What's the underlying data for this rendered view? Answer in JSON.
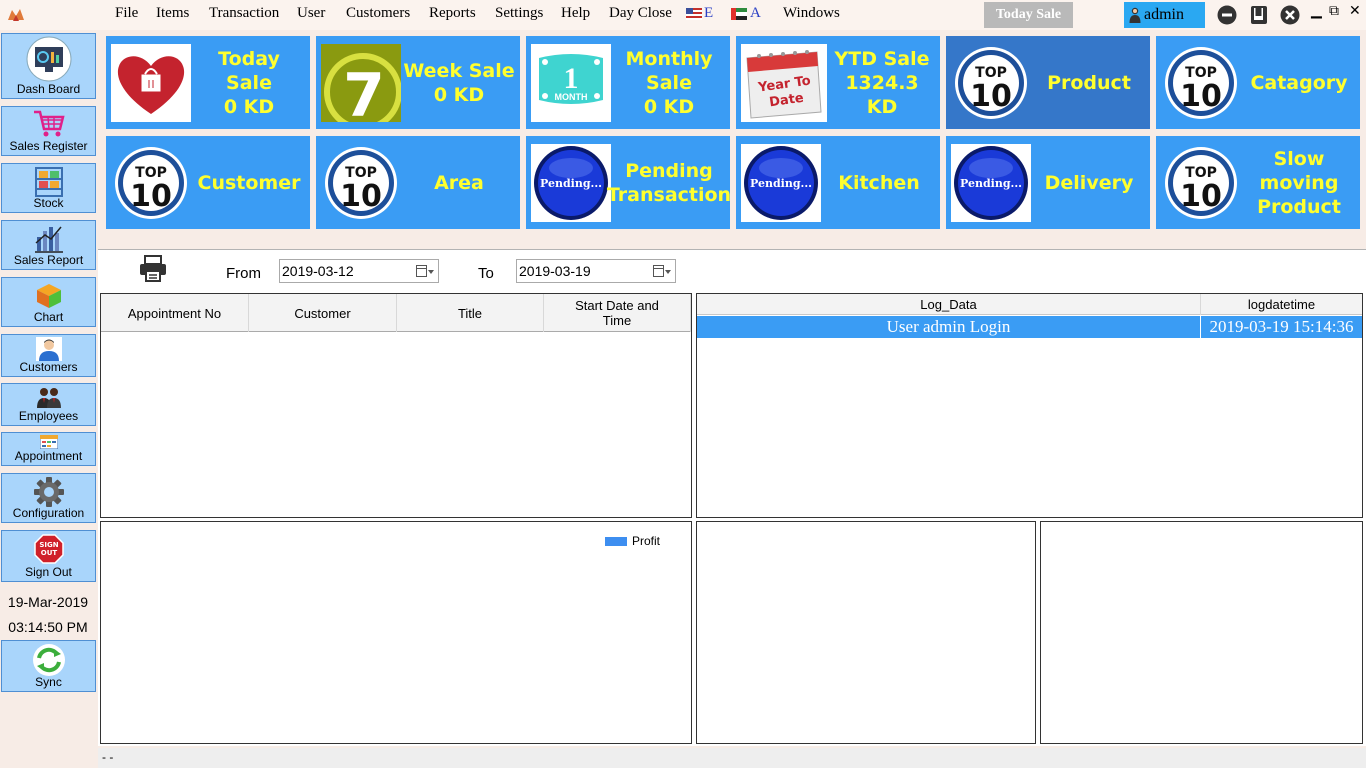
{
  "menu": {
    "items": [
      "File",
      "Items",
      "Transaction",
      "User",
      "Customers",
      "Reports",
      "Settings",
      "Help",
      "Day Close"
    ],
    "lang_english": "E",
    "lang_arabic": "A",
    "windows": "Windows",
    "today_sale_button": "Today Sale",
    "user": "admin"
  },
  "sidebar": {
    "items": [
      {
        "label": "Dash Board",
        "icon": "dashboard-icon"
      },
      {
        "label": "Sales Register",
        "icon": "cart-icon"
      },
      {
        "label": "Stock",
        "icon": "shelf-icon"
      },
      {
        "label": "Sales Report",
        "icon": "report-icon"
      },
      {
        "label": "Chart",
        "icon": "chart-icon"
      },
      {
        "label": "Customers",
        "icon": "customer-icon"
      },
      {
        "label": "Employees",
        "icon": "employees-icon"
      },
      {
        "label": "Appointment",
        "icon": "appointment-icon"
      },
      {
        "label": "Configuration",
        "icon": "gear-icon"
      },
      {
        "label": "Sign Out",
        "icon": "sign-out-icon"
      },
      {
        "label": "Sync",
        "icon": "sync-icon"
      }
    ],
    "date": "19-Mar-2019",
    "time": "03:14:50 PM"
  },
  "tiles": [
    {
      "lines": [
        "Today Sale",
        "0 KD"
      ],
      "icon": "heart-bag-icon"
    },
    {
      "lines": [
        "Week Sale",
        "0 KD"
      ],
      "icon": "seven-icon"
    },
    {
      "lines": [
        "Monthly",
        "Sale",
        "0 KD"
      ],
      "icon": "one-month-icon",
      "icon_label": "1",
      "icon_sub": "MONTH"
    },
    {
      "lines": [
        "YTD Sale",
        "1324.3 KD"
      ],
      "icon": "year-to-date-icon",
      "icon_label": "Year To",
      "icon_sub": "Date"
    },
    {
      "lines": [
        "Product"
      ],
      "icon": "top10-icon"
    },
    {
      "lines": [
        "Catagory"
      ],
      "icon": "top10-icon"
    },
    {
      "lines": [
        "Customer"
      ],
      "icon": "top10-icon"
    },
    {
      "lines": [
        "Area"
      ],
      "icon": "top10-icon"
    },
    {
      "lines": [
        "Pending",
        "Transaction"
      ],
      "icon": "pending-icon"
    },
    {
      "lines": [
        "Kitchen"
      ],
      "icon": "pending-icon"
    },
    {
      "lines": [
        "Delivery"
      ],
      "icon": "pending-icon"
    },
    {
      "lines": [
        "Slow",
        "moving",
        "Product"
      ],
      "icon": "top10-icon"
    }
  ],
  "badges": {
    "top": "TOP",
    "ten": "10",
    "pending": "Pending...",
    "seven": "7"
  },
  "filter": {
    "from_label": "From",
    "from_value": "2019-03-12",
    "to_label": "To",
    "to_value": "2019-03-19"
  },
  "appointments": {
    "columns": [
      "Appointment No",
      "Customer",
      "Title",
      "Start Date and Time"
    ]
  },
  "log": {
    "columns": [
      "Log_Data",
      "logdatetime"
    ],
    "rows": [
      {
        "data": "User admin Login",
        "datetime": "2019-03-19 15:14:36"
      }
    ]
  },
  "chart_data": {
    "type": "bar",
    "series": [
      {
        "name": "Profit",
        "values": []
      }
    ],
    "legend": "top-right",
    "color": "#3d8ef0"
  },
  "statusbar": {
    "text": "- -"
  }
}
